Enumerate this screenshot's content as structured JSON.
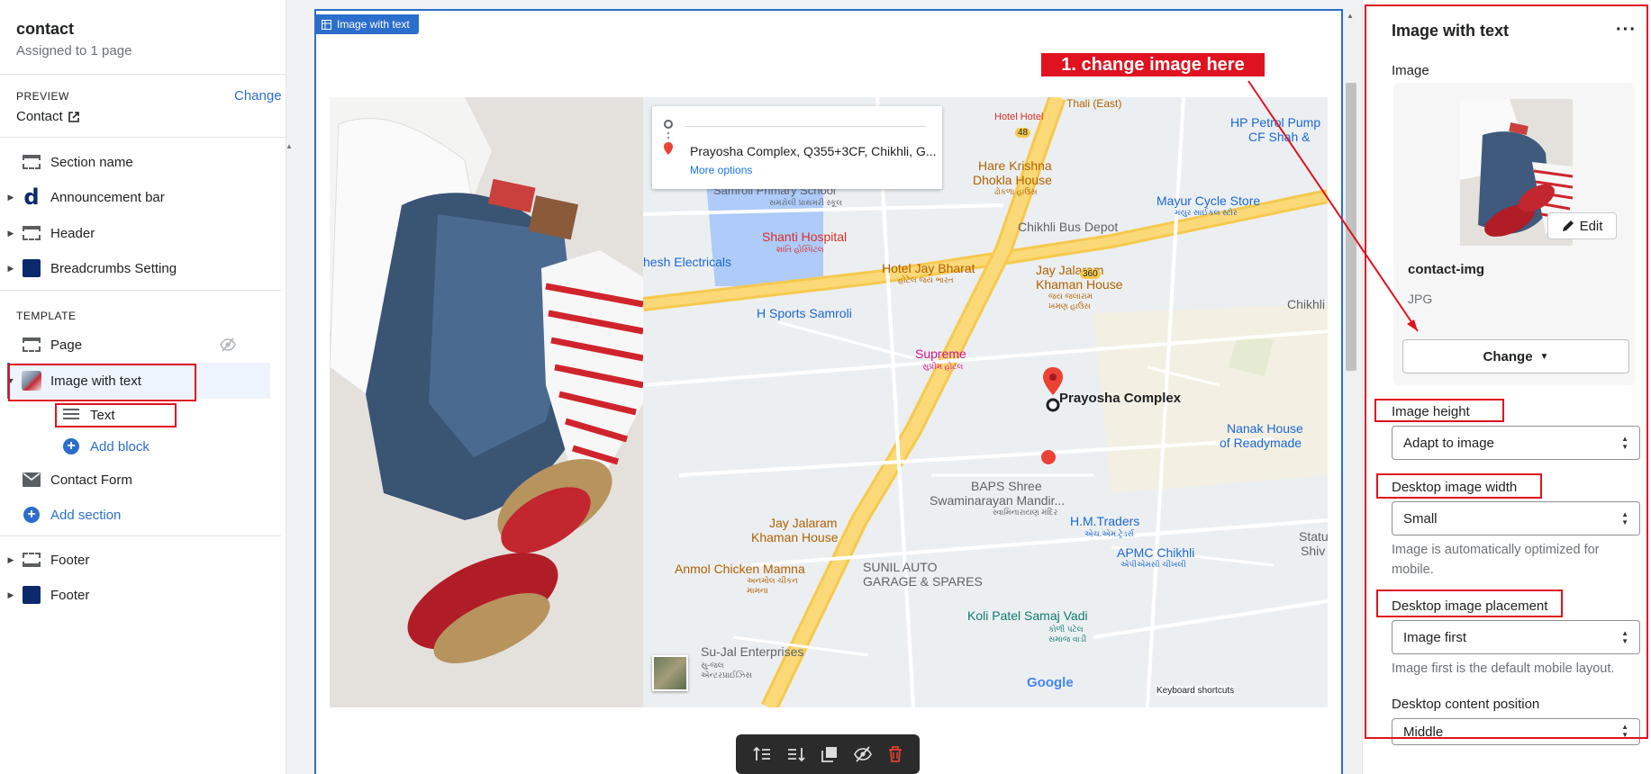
{
  "sidebar": {
    "title": "contact",
    "subtitle": "Assigned to 1 page",
    "preview_label": "PREVIEW",
    "preview_value": "Contact",
    "change_link": "Change",
    "items": [
      {
        "label": "Section name"
      },
      {
        "label": "Announcement bar"
      },
      {
        "label": "Header"
      },
      {
        "label": "Breadcrumbs Setting"
      }
    ],
    "template_label": "TEMPLATE",
    "template_items": [
      {
        "label": "Page"
      },
      {
        "label": "Image with text"
      },
      {
        "label": "Text"
      },
      {
        "label": "Add block"
      },
      {
        "label": "Contact Form"
      },
      {
        "label": "Add section"
      }
    ],
    "footer_items": [
      {
        "label": "Footer"
      },
      {
        "label": "Footer"
      }
    ]
  },
  "canvas": {
    "badge": "Image with text",
    "map": {
      "place": "Prayosha Complex, Q355+3CF, Chikhli, G...",
      "more_options": "More options",
      "pin_label": "Prayosha Complex",
      "keyboard_shortcuts": "Keyboard shortcuts",
      "google": "Google",
      "labels": {
        "l1": "Samroli Primary School",
        "l1s": "સમરોલી પ્રાથમરી સ્કૂલ",
        "l2": "Shanti Hospital",
        "l2s": "શાંતિ હોસ્પિટલ",
        "l3": "hesh Electricals",
        "l4": "H Sports Samroli",
        "l5": "Hotel Jay Bharat",
        "l5s": "હોટેલ જય ભારત",
        "l6": "Hare Krishna",
        "l6b": "Dhokla House",
        "l6s": "ઢોકળા હાઉસ",
        "l7": "Chikhli Bus Depot",
        "l8": "Mayur Cycle Store",
        "l8s": "મયુર સાઈકલ સ્ટોર",
        "l9": "HP Petrol Pump",
        "l9b": "CF Shah &",
        "l10": "Jay Jalaram",
        "l10b": "Khaman House",
        "l10s": "જય જલારામ ખમણ હાઉસ",
        "l11": "Chikhli",
        "l12": "Supreme",
        "l12s": "સુપ્રીમ હોટલ",
        "l13": "Nanak House",
        "l13b": "of Readymade",
        "l14": "BAPS Shree",
        "l14b": "Swaminarayan Mandir...",
        "l14s": "સ્વામિનારાયણ મંદિર",
        "l15": "H.M.Traders",
        "l15s": "એચ.એમ.ટ્રેડર્સ",
        "l16": "APMC Chikhli",
        "l16s": "એપીએમસી ચીખલી",
        "l17": "Jay Jalaram",
        "l17b": "Khaman House",
        "l18": "SUNIL AUTO",
        "l18b": "GARAGE & SPARES",
        "l19": "Anmol Chicken Mamna",
        "l19s": "અનમોલ ચીકન મામના",
        "l20": "Koli Patel Samaj Vadi",
        "l20s": "કોળી પટેલ સમાજ વાડી",
        "l21": "Su-Jal Enterprises",
        "l21s": "સુ-જલ એન્ટરપ્રાઈઝિસ",
        "l22": "Statu",
        "l22b": "Shiv",
        "r48": "48",
        "r360": "360",
        "l23": "Hotel Hotel",
        "l24": "Thali (East)"
      }
    },
    "annotation": "1. change image here"
  },
  "panel": {
    "title": "Image with text",
    "more": "···",
    "image_label": "Image",
    "edit": "Edit",
    "filename": "contact-img",
    "filetype": "JPG",
    "change": "Change",
    "image_height_label": "Image height",
    "image_height_value": "Adapt to image",
    "desktop_width_label": "Desktop image width",
    "desktop_width_value": "Small",
    "desktop_width_help": "Image is automatically optimized for mobile.",
    "placement_label": "Desktop image placement",
    "placement_value": "Image first",
    "placement_help": "Image first is the default mobile layout.",
    "content_position_label": "Desktop content position",
    "content_position_value": "Middle"
  },
  "colors": {
    "accent": "#2c6ecb",
    "annotation_red": "#e0121f",
    "road_yellow": "#f9c74f"
  }
}
